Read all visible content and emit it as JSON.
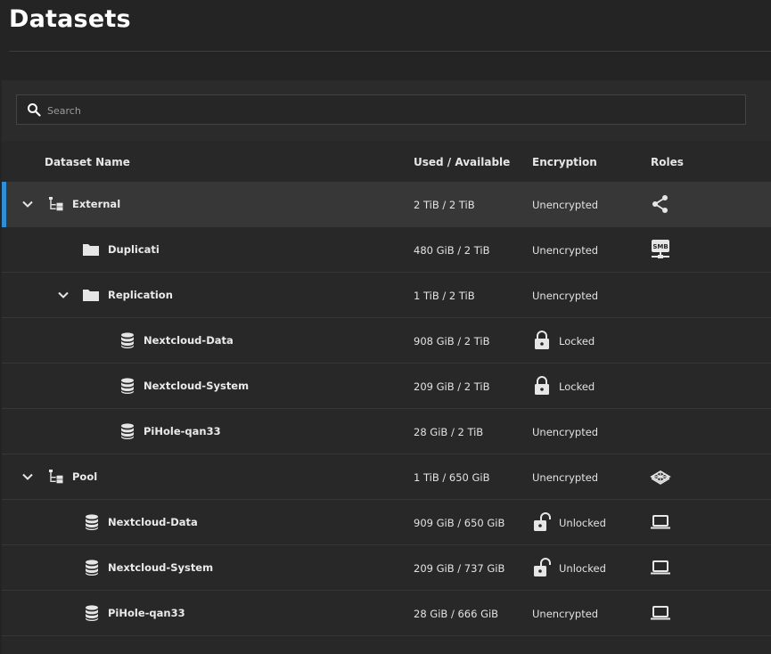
{
  "page": {
    "title": "Datasets"
  },
  "search": {
    "placeholder": "Search",
    "value": ""
  },
  "columns": {
    "name": "Dataset Name",
    "used": "Used / Available",
    "encryption": "Encryption",
    "roles": "Roles"
  },
  "accent_color": "#2f8fd6",
  "rows": [
    {
      "name": "External",
      "used": "2 TiB / 2 TiB",
      "encryption": "Unencrypted",
      "type": "pool-icon",
      "role": "share-icon",
      "expanded": true,
      "selected": true
    },
    {
      "name": "Duplicati",
      "used": "480 GiB / 2 TiB",
      "encryption": "Unencrypted",
      "type": "folder-icon",
      "role": "smb-share-icon"
    },
    {
      "name": "Replication",
      "used": "1 TiB / 2 TiB",
      "encryption": "Unencrypted",
      "type": "folder-icon",
      "expanded": true
    },
    {
      "name": "Nextcloud-Data",
      "used": "908 GiB / 2 TiB",
      "encryption": "Locked",
      "type": "database-icon",
      "lock": "locked"
    },
    {
      "name": "Nextcloud-System",
      "used": "209 GiB / 2 TiB",
      "encryption": "Locked",
      "type": "database-icon",
      "lock": "locked"
    },
    {
      "name": "PiHole-qan33",
      "used": "28 GiB / 2 TiB",
      "encryption": "Unencrypted",
      "type": "database-icon"
    },
    {
      "name": "Pool",
      "used": "1 TiB / 650 GiB",
      "encryption": "Unencrypted",
      "type": "pool-icon",
      "role": "layers-icon",
      "expanded": true
    },
    {
      "name": "Nextcloud-Data",
      "used": "909 GiB / 650 GiB",
      "encryption": "Unlocked",
      "type": "database-icon",
      "lock": "unlocked",
      "role": "laptop-icon"
    },
    {
      "name": "Nextcloud-System",
      "used": "209 GiB / 737 GiB",
      "encryption": "Unlocked",
      "type": "database-icon",
      "lock": "unlocked",
      "role": "laptop-icon"
    },
    {
      "name": "PiHole-qan33",
      "used": "28 GiB / 666 GiB",
      "encryption": "Unencrypted",
      "type": "database-icon",
      "role": "laptop-icon"
    }
  ]
}
